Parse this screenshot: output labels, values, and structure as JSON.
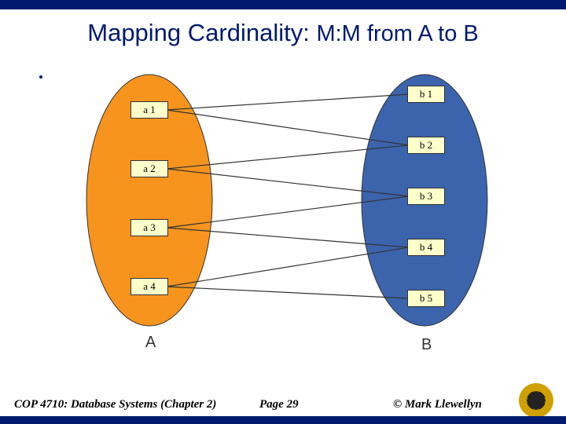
{
  "title_main": "Mapping Cardinality:",
  "title_sub": "M:M from A to B",
  "setA": {
    "label": "A",
    "color": "#f7941e",
    "nodes": [
      "a 1",
      "a 2",
      "a 3",
      "a 4"
    ]
  },
  "setB": {
    "label": "B",
    "color": "#3b64ad",
    "nodes": [
      "b 1",
      "b 2",
      "b 3",
      "b 4",
      "b 5"
    ]
  },
  "edges": [
    {
      "from": "a1",
      "to": "b1"
    },
    {
      "from": "a1",
      "to": "b2"
    },
    {
      "from": "a2",
      "to": "b2"
    },
    {
      "from": "a2",
      "to": "b3"
    },
    {
      "from": "a3",
      "to": "b3"
    },
    {
      "from": "a3",
      "to": "b4"
    },
    {
      "from": "a4",
      "to": "b4"
    },
    {
      "from": "a4",
      "to": "b5"
    }
  ],
  "footer": {
    "course": "COP 4710: Database Systems  (Chapter 2)",
    "page": "Page 29",
    "author": "© Mark Llewellyn"
  },
  "logo_colors": {
    "outer": "#d0a000",
    "inner": "#222"
  }
}
